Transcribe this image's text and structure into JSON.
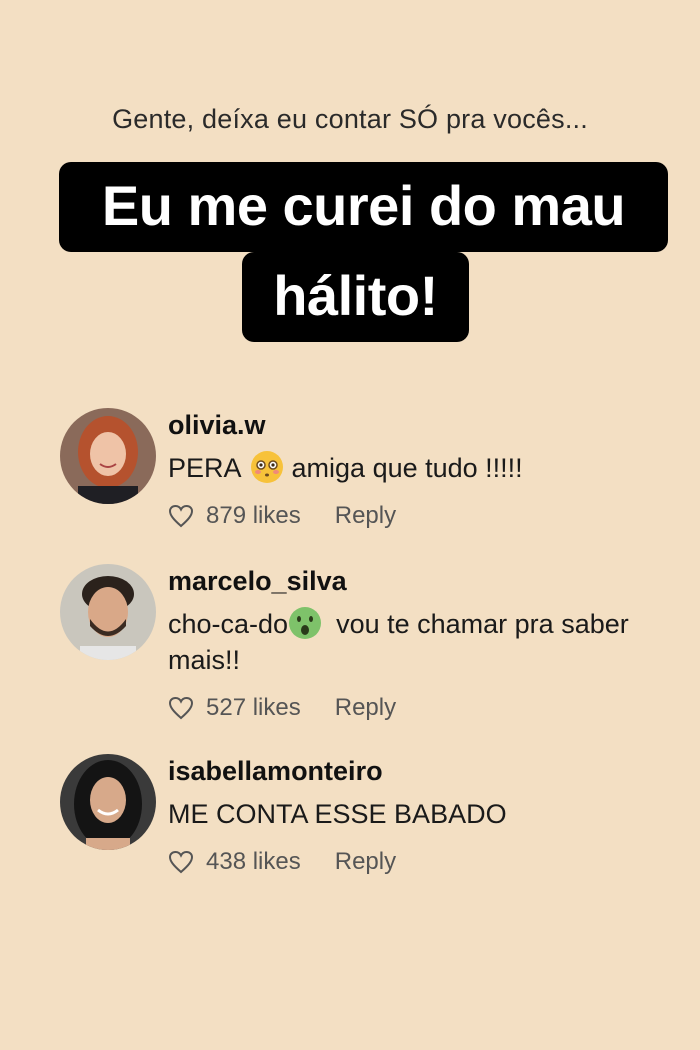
{
  "intro": "Gente, deíxa eu contar SÓ pra vocês...",
  "headline": {
    "line1": "Eu me curei do mau",
    "line2": "hálito!"
  },
  "comments": [
    {
      "username": "olivia.w",
      "text_before": "PERA",
      "emoji": "flushed-face-icon",
      "text_after": "amiga que tudo !!!!!",
      "likes": "879 likes",
      "reply": "Reply"
    },
    {
      "username": "marcelo_silva",
      "text_before": "cho-ca-do",
      "emoji": "face-with-open-mouth-icon",
      "text_after": "vou te chamar pra saber mais!!",
      "likes": "527 likes",
      "reply": "Reply"
    },
    {
      "username": "isabellamonteiro",
      "text": "ME CONTA ESSE BABADO",
      "likes": "438 likes",
      "reply": "Reply"
    }
  ],
  "colors": {
    "background": "#f3dfc3",
    "headline_bg": "#000000",
    "headline_text": "#ffffff"
  }
}
